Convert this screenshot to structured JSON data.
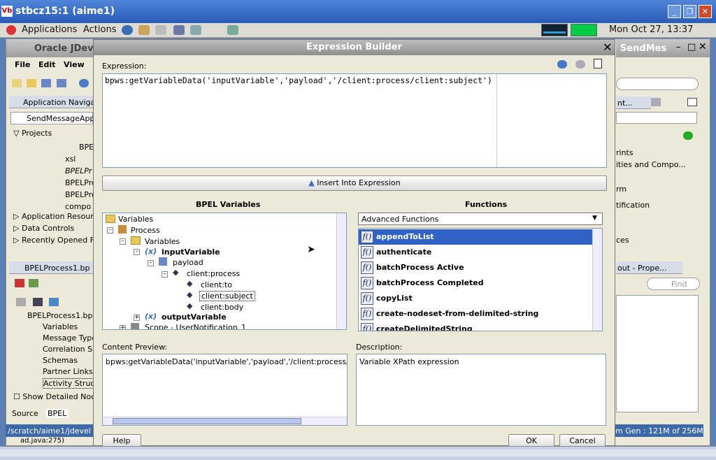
{
  "os": {
    "window_title": "stbcz15:1 (aime1)",
    "vbox_label": "Vb",
    "menu_applications": "Applications",
    "menu_actions": "Actions",
    "clock": "Mon Oct 27, 13:37"
  },
  "jdev": {
    "title": "Oracle JDev",
    "right_title": "SendMes",
    "menu": [
      "File",
      "Edit",
      "View"
    ],
    "app_navigator_tab": "Application Naviga",
    "app_combo": "SendMessageApp",
    "projects_header": "Projects",
    "project_items": [
      "BPE",
      "xsl",
      "BPELPr",
      "BPELPro",
      "BPELPro",
      "compo"
    ],
    "app_resources": "Application Resour",
    "data_controls": "Data Controls",
    "recently_opened": "Recently Opened F",
    "structure_tab": "BPELProcess1.bp",
    "structure_root": "BPELProcess1.bp",
    "structure_items": [
      "Variables",
      "Message Type",
      "Correlation S",
      "Schemas",
      "Partner Links",
      "Activity Struc"
    ],
    "show_detailed": "Show Detailed Noc",
    "source_tab": "Source",
    "bpel_tab": "BPEL",
    "status_left": "/scratch/aime1/jdevel",
    "bottom_path": "ad.java:275)",
    "right_items": [
      "nt...",
      "rints",
      "ities and Compo...",
      "rm",
      "tification",
      "ces"
    ],
    "right_prop_tab": "out - Prope...",
    "find_placeholder": "Find",
    "status_right": "m Gen : 121M of 256M"
  },
  "dialog": {
    "title": "Expression Builder",
    "expression_label": "Expression:",
    "expression_value": "bpws:getVariableData('inputVariable','payload','/client:process/client:subject')",
    "insert_button": "Insert Into Expression",
    "bpel_variables_label": "BPEL Variables",
    "functions_label": "Functions",
    "functions_category": "Advanced Functions",
    "tree": [
      "Variables",
      "Process",
      "Variables",
      "inputVariable",
      "payload",
      "client:process",
      "client:to",
      "client:subject",
      "client:body",
      "outputVariable",
      "Scope - UserNotification_1"
    ],
    "functions": [
      "appendToList",
      "authenticate",
      "batchProcess Active",
      "batchProcess Completed",
      "copyList",
      "create-nodeset-from-delimited-string",
      "createDelimitedString"
    ],
    "fx_glyph": "f()",
    "content_preview_label": "Content Preview:",
    "content_preview_value": "bpws:getVariableData('inputVariable','payload','/client:process/c",
    "description_label": "Description:",
    "description_value": "Variable XPath expression",
    "help_button": "Help",
    "ok_button": "OK",
    "cancel_button": "Cancel"
  },
  "colors": {
    "selection": "#3163c6",
    "title_blue": "#2a5cb8"
  }
}
